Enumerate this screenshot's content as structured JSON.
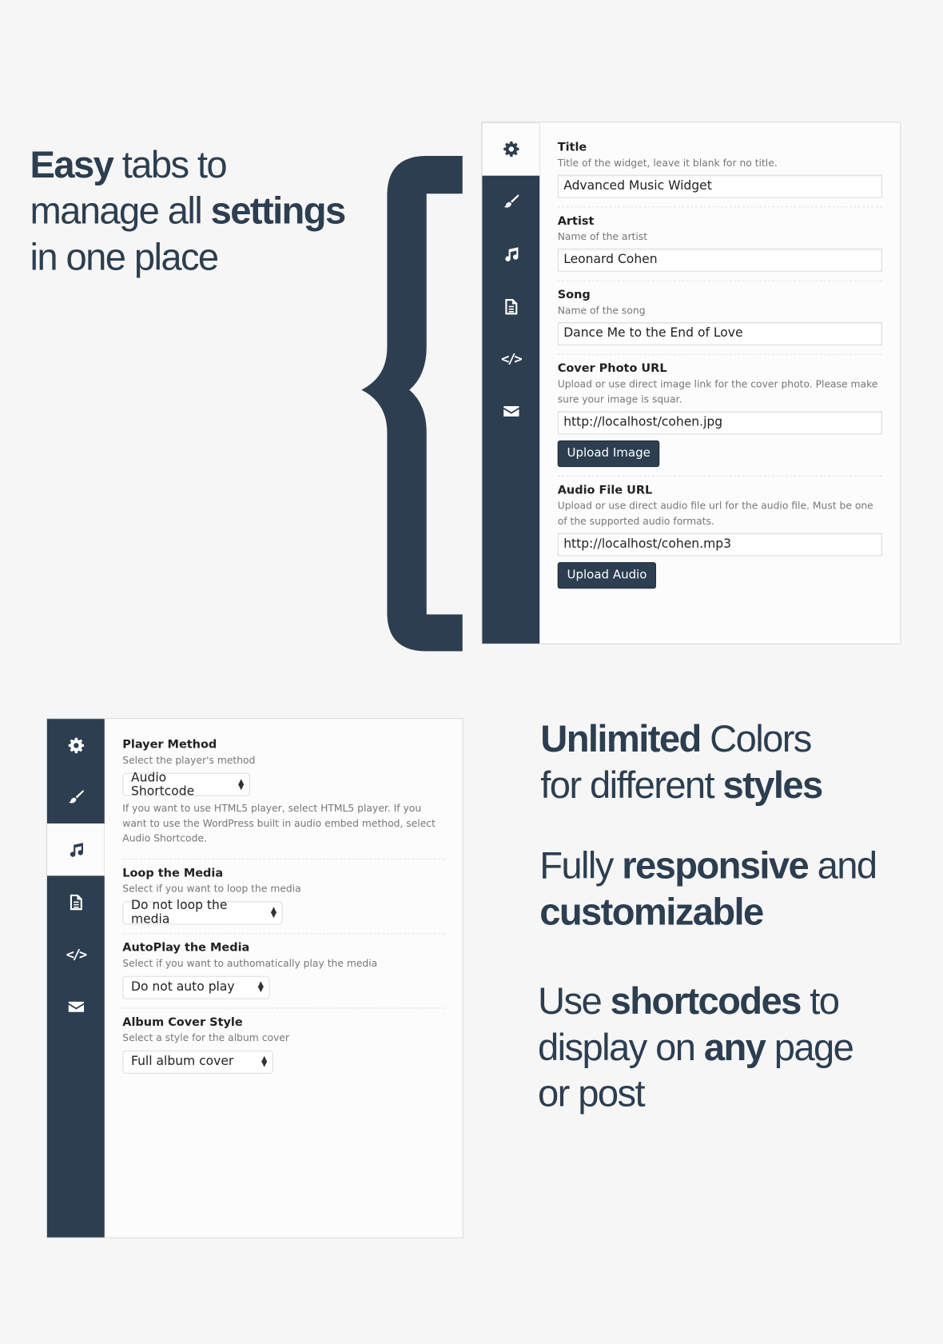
{
  "headlines": {
    "tabs": {
      "b1": "Easy",
      "t1": " tabs to",
      "t2": "manage all ",
      "b2": "settings",
      "t3": "in one place"
    },
    "colors": {
      "b1": "Unlimited",
      "t1": " Colors",
      "t2": "for different ",
      "b2": "styles"
    },
    "responsive": {
      "t1": "Fully ",
      "b1": "responsive",
      "t2": " and",
      "b2": "customizable"
    },
    "shortcodes": {
      "t1": "Use ",
      "b1": "shortcodes",
      "t2": " to",
      "t3": "display on ",
      "b2": "any",
      "t4": " page",
      "t5": "or post"
    }
  },
  "colors": {
    "brand": "#2c3e50",
    "background": "#f6f6f6",
    "panel": "#fcfcfc"
  },
  "tabs": [
    "gear-icon",
    "brush-icon",
    "music-icon",
    "document-icon",
    "code-icon",
    "envelope-icon"
  ],
  "code_glyph": "</>",
  "panel1": {
    "active_tab": "gear-icon",
    "fields": [
      {
        "label": "Title",
        "desc": "Title of the widget, leave it blank for no title.",
        "value": "Advanced Music Widget"
      },
      {
        "label": "Artist",
        "desc": "Name of the artist",
        "value": "Leonard Cohen"
      },
      {
        "label": "Song",
        "desc": "Name of the song",
        "value": "Dance Me to the End of Love"
      },
      {
        "label": "Cover Photo URL",
        "desc": "Upload or use direct image link for the cover photo. Please make sure your image is squar.",
        "value": "http://localhost/cohen.jpg",
        "button": "Upload Image"
      },
      {
        "label": "Audio File URL",
        "desc": "Upload or use direct audio file url for the audio file. Must be one of the supported audio formats.",
        "value": "http://localhost/cohen.mp3",
        "button": "Upload Audio"
      }
    ]
  },
  "panel2": {
    "active_tab": "music-icon",
    "fields": [
      {
        "label": "Player Method",
        "desc": "Select the player's method",
        "value": "Audio Shortcode",
        "help": "If you want to use HTML5 player, select HTML5 player. If you want to use the WordPress built in audio embed method, select Audio Shortcode."
      },
      {
        "label": "Loop the Media",
        "desc": "Select if you want to loop the media",
        "value": "Do not loop the media"
      },
      {
        "label": "AutoPlay the Media",
        "desc": "Select if you want to authomatically play the media",
        "value": "Do not auto play"
      },
      {
        "label": "Album Cover Style",
        "desc": "Select a style for the album cover",
        "value": "Full album cover"
      }
    ]
  }
}
